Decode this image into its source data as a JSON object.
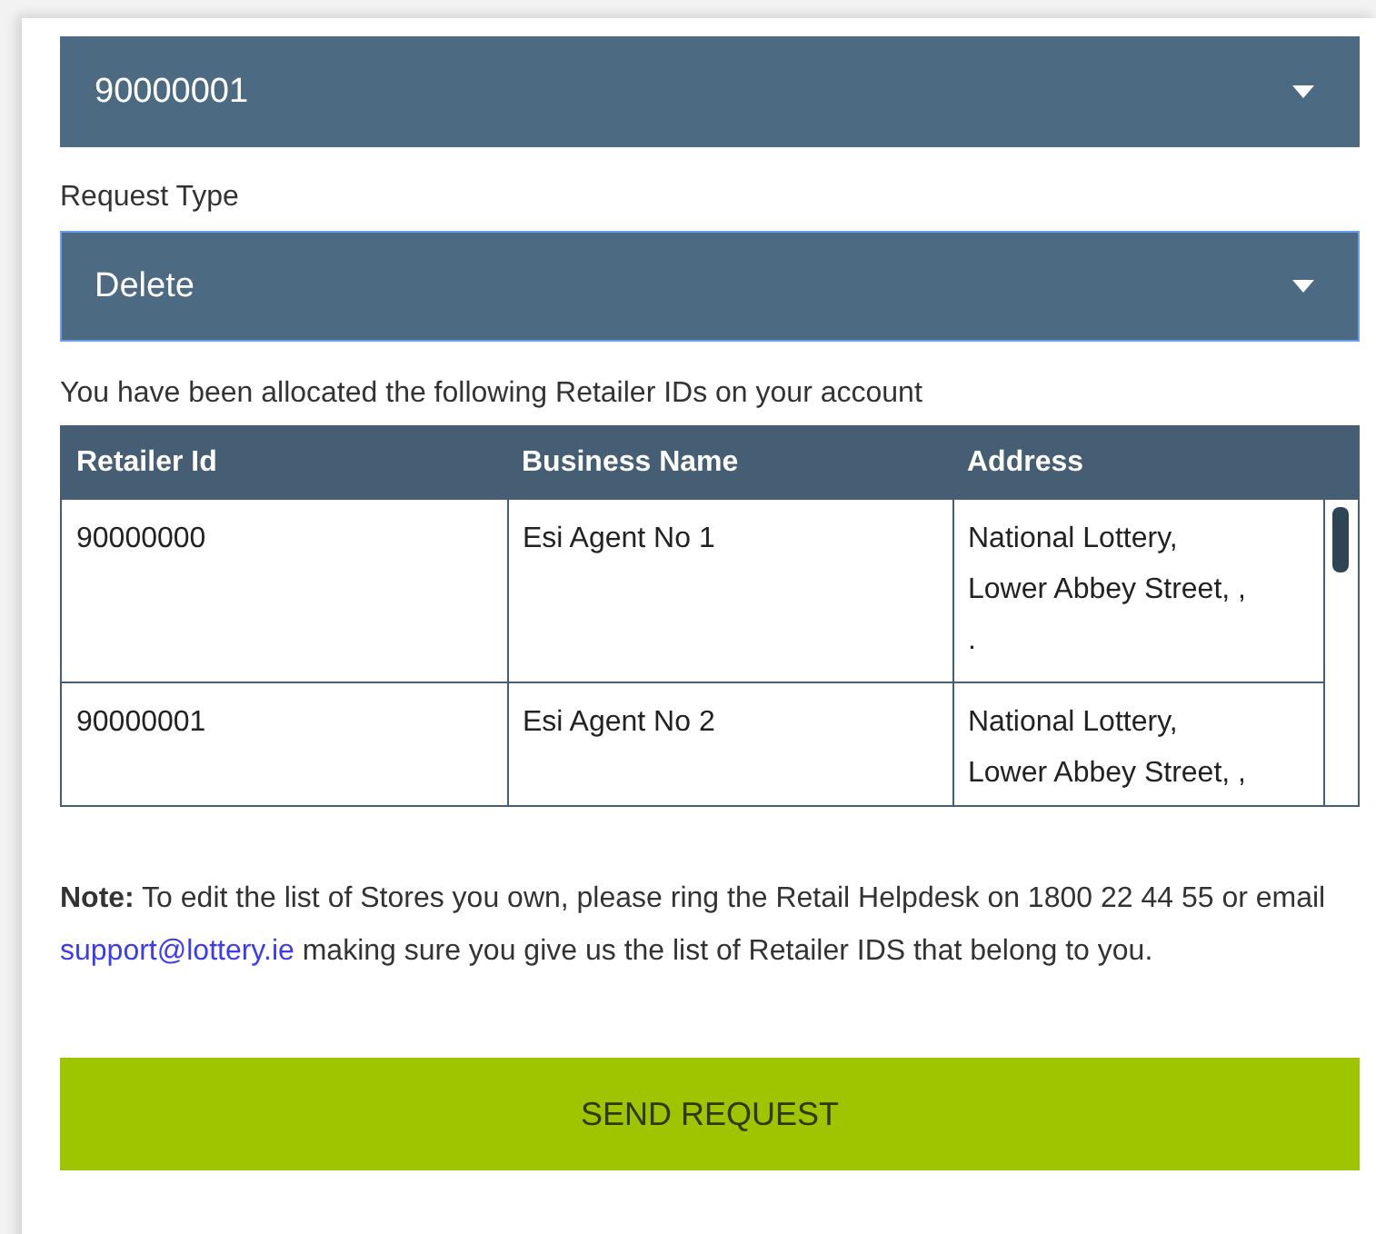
{
  "retailer_select": {
    "value": "90000001",
    "focused": false
  },
  "request_type": {
    "label": "Request Type",
    "value": "Delete",
    "focused": true
  },
  "allocated_text": "You have been allocated the following Retailer IDs on your account",
  "table": {
    "columns": [
      "Retailer Id",
      "Business Name",
      "Address"
    ],
    "rows": [
      {
        "retailer_id": "90000000",
        "business_name": "Esi Agent No 1",
        "address_lines": [
          "National Lottery,",
          "Lower Abbey Street, ,",
          "."
        ]
      },
      {
        "retailer_id": "90000001",
        "business_name": "Esi Agent No 2",
        "address_lines": [
          "National Lottery,",
          "Lower Abbey Street, ,"
        ]
      }
    ]
  },
  "note": {
    "before": "**Note:** To edit the list of Stores you own, please ring the Retail Helpdesk on 1800 22 44 55 or email ",
    "link": "support@lottery.ie",
    "after": " making sure you give us the list of Retailer IDS that belong to you."
  },
  "send_button": "SEND REQUEST"
}
